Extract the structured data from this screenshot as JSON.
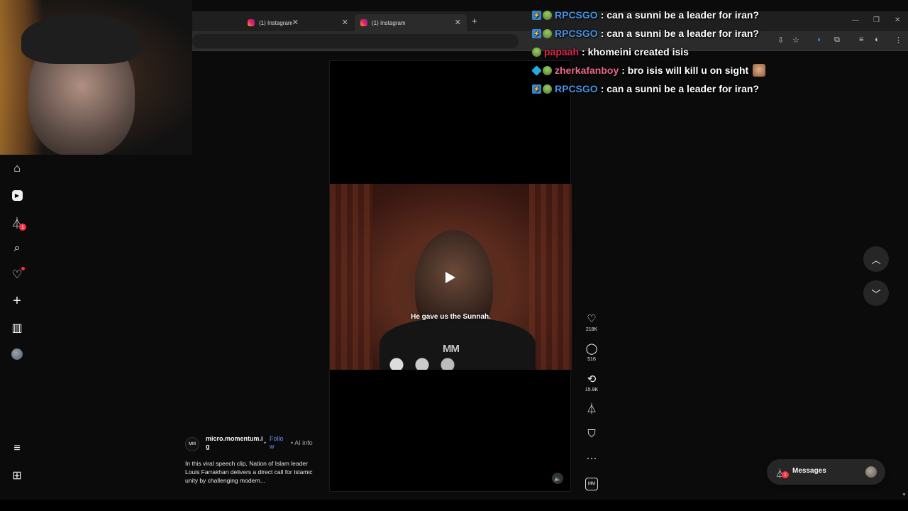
{
  "browser": {
    "tabs": [
      {
        "title": "",
        "active": false
      },
      {
        "title": "(1) Instagram",
        "active": false
      },
      {
        "title": "(1) Instagram",
        "active": true
      }
    ],
    "new_tab_icon": "plus-icon",
    "window_controls": [
      "minimize-icon",
      "restore-icon",
      "close-icon"
    ],
    "toolbar_icons": [
      "install-icon",
      "star-icon",
      "read-aloud-icon",
      "extensions-icon",
      "media-icon",
      "profile-icon",
      "menu-icon"
    ]
  },
  "nav": {
    "items": [
      {
        "name": "home-icon",
        "glyph": "⌂"
      },
      {
        "name": "reels-icon",
        "glyph": "▶"
      },
      {
        "name": "direct-icon",
        "glyph": "⏃",
        "badge": "1"
      },
      {
        "name": "search-icon",
        "glyph": "⌕"
      },
      {
        "name": "notifications-icon",
        "glyph": "♡"
      },
      {
        "name": "create-icon",
        "glyph": "+"
      },
      {
        "name": "dashboard-icon",
        "glyph": "▥"
      },
      {
        "name": "profile-avatar",
        "glyph": ""
      }
    ],
    "more_icon": "≡",
    "apps_icon": "⊞"
  },
  "reel": {
    "subtitle": "He gave us the Sunnah.",
    "watermark": "MM",
    "author": {
      "avatar_text": "MM",
      "name": "micro.momentum.ig",
      "follow": "Follow",
      "ai_info": "AI info"
    },
    "caption": "In this viral speech clip, Nation of Islam leader Louis Farrakhan delivers a direct call for Islamic unity by challenging modern...",
    "actions": {
      "likes": "218K",
      "comments": "516",
      "reposts": "15.9K"
    }
  },
  "messages": {
    "label": "Messages",
    "badge": "1"
  },
  "chat": [
    {
      "user": "RPCSGO",
      "color": "#4a90e2",
      "message": ": can a sunni be a leader for iran?",
      "badges": [
        "b1",
        "b2"
      ],
      "emote": false
    },
    {
      "user": "RPCSGO",
      "color": "#4a90e2",
      "message": ": can a sunni be a leader for iran?",
      "badges": [
        "b1",
        "b2"
      ],
      "emote": false
    },
    {
      "user": "papaah",
      "color": "#e0234a",
      "message": ": khomeini created isis",
      "badges": [
        "b2"
      ],
      "emote": false
    },
    {
      "user": "zherkafanboy",
      "color": "#e86a8a",
      "message": ": bro isis will kill u on sight",
      "badges": [
        "b3",
        "b2"
      ],
      "emote": true
    },
    {
      "user": "RPCSGO",
      "color": "#4a90e2",
      "message": ": can a sunni be a leader for iran?",
      "badges": [
        "b1",
        "b2"
      ],
      "emote": false
    }
  ]
}
